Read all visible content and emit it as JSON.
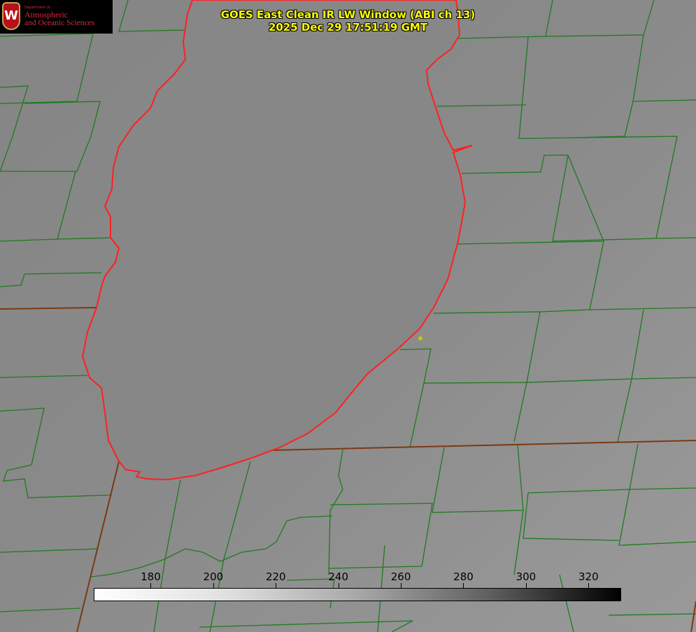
{
  "title_line1": "GOES East Clean IR LW Window (ABI ch 13)",
  "title_line2": "2025 Dec 29 17:51:19 GMT",
  "logo": {
    "department": "Department of",
    "line1": "Atmospheric",
    "line2": "and Oceanic Sciences",
    "emblem": "W"
  },
  "colorbar": {
    "ticks": [
      "180",
      "200",
      "220",
      "240",
      "260",
      "280",
      "300",
      "320"
    ],
    "tick_values": [
      180,
      200,
      220,
      240,
      260,
      280,
      300,
      320
    ],
    "range": [
      162,
      330
    ],
    "colormap": "white-to-black"
  },
  "colors": {
    "county_lines": "#1f7a1f",
    "state_lines": "#7a3a10",
    "coastline": "#ff2020",
    "title": "#ffff00"
  }
}
